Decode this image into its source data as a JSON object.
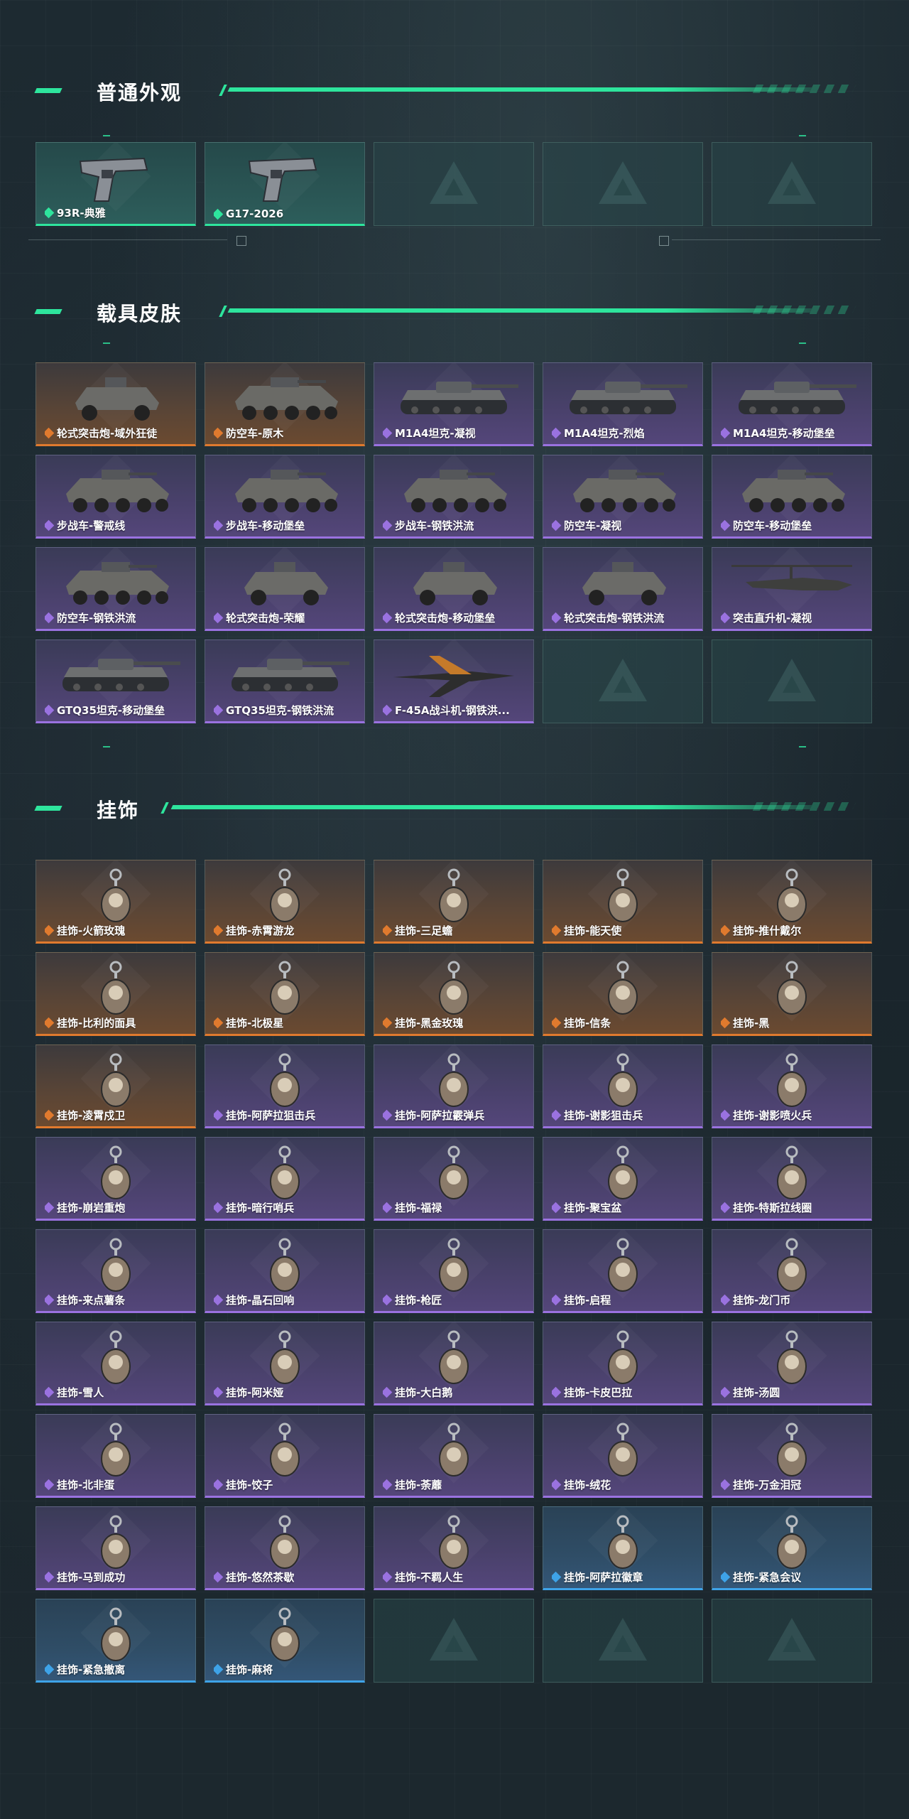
{
  "colors": {
    "accent": "#2ee59d",
    "gold": "#e07a2e",
    "purple": "#9a72e0",
    "blue": "#3ea3e8"
  },
  "sections": [
    {
      "title": "普通外观",
      "items": [
        {
          "label": "93R-典雅",
          "rarity": "green",
          "icon": "pistol-icon"
        },
        {
          "label": "G17-2026",
          "rarity": "green",
          "icon": "pistol-icon"
        },
        {
          "label": "",
          "rarity": "empty"
        },
        {
          "label": "",
          "rarity": "empty"
        },
        {
          "label": "",
          "rarity": "empty"
        }
      ]
    },
    {
      "title": "载具皮肤",
      "items": [
        {
          "label": "轮式突击炮-域外狂徒",
          "rarity": "gold",
          "icon": "armored-car-icon"
        },
        {
          "label": "防空车-原木",
          "rarity": "gold",
          "icon": "ifv-icon"
        },
        {
          "label": "M1A4坦克-凝视",
          "rarity": "purple",
          "icon": "tank-icon"
        },
        {
          "label": "M1A4坦克-烈焰",
          "rarity": "purple",
          "icon": "tank-icon"
        },
        {
          "label": "M1A4坦克-移动堡垒",
          "rarity": "purple",
          "icon": "tank-icon"
        },
        {
          "label": "步战车-警戒线",
          "rarity": "purple",
          "icon": "ifv-icon"
        },
        {
          "label": "步战车-移动堡垒",
          "rarity": "purple",
          "icon": "ifv-icon"
        },
        {
          "label": "步战车-钢铁洪流",
          "rarity": "purple",
          "icon": "ifv-icon"
        },
        {
          "label": "防空车-凝视",
          "rarity": "purple",
          "icon": "ifv-icon"
        },
        {
          "label": "防空车-移动堡垒",
          "rarity": "purple",
          "icon": "ifv-icon"
        },
        {
          "label": "防空车-钢铁洪流",
          "rarity": "purple",
          "icon": "ifv-icon"
        },
        {
          "label": "轮式突击炮-荣耀",
          "rarity": "purple",
          "icon": "armored-car-icon"
        },
        {
          "label": "轮式突击炮-移动堡垒",
          "rarity": "purple",
          "icon": "armored-car-icon"
        },
        {
          "label": "轮式突击炮-钢铁洪流",
          "rarity": "purple",
          "icon": "armored-car-icon"
        },
        {
          "label": "突击直升机-凝视",
          "rarity": "purple",
          "icon": "helicopter-icon"
        },
        {
          "label": "GTQ35坦克-移动堡垒",
          "rarity": "purple",
          "icon": "tank-icon"
        },
        {
          "label": "GTQ35坦克-钢铁洪流",
          "rarity": "purple",
          "icon": "tank-icon"
        },
        {
          "label": "F-45A战斗机-钢铁洪...",
          "rarity": "purple",
          "icon": "jet-icon"
        },
        {
          "label": "",
          "rarity": "empty"
        },
        {
          "label": "",
          "rarity": "empty"
        }
      ]
    },
    {
      "title": "挂饰",
      "items": [
        {
          "label": "挂饰-火箭玫瑰",
          "rarity": "gold",
          "icon": "charm-icon"
        },
        {
          "label": "挂饰-赤霄游龙",
          "rarity": "gold",
          "icon": "charm-icon"
        },
        {
          "label": "挂饰-三足蟾",
          "rarity": "gold",
          "icon": "charm-icon"
        },
        {
          "label": "挂饰-能天使",
          "rarity": "gold",
          "icon": "charm-icon"
        },
        {
          "label": "挂饰-推什戴尔",
          "rarity": "gold",
          "icon": "charm-icon"
        },
        {
          "label": "挂饰-比利的面具",
          "rarity": "gold",
          "icon": "charm-icon"
        },
        {
          "label": "挂饰-北极星",
          "rarity": "gold",
          "icon": "charm-icon"
        },
        {
          "label": "挂饰-黑金玫瑰",
          "rarity": "gold",
          "icon": "charm-icon"
        },
        {
          "label": "挂饰-信条",
          "rarity": "gold",
          "icon": "charm-icon"
        },
        {
          "label": "挂饰-黑",
          "rarity": "gold",
          "icon": "charm-icon"
        },
        {
          "label": "挂饰-凌霄戍卫",
          "rarity": "gold",
          "icon": "charm-icon"
        },
        {
          "label": "挂饰-阿萨拉狙击兵",
          "rarity": "purple",
          "icon": "charm-icon"
        },
        {
          "label": "挂饰-阿萨拉霰弹兵",
          "rarity": "purple",
          "icon": "charm-icon"
        },
        {
          "label": "挂饰-谢影狙击兵",
          "rarity": "purple",
          "icon": "charm-icon"
        },
        {
          "label": "挂饰-谢影喷火兵",
          "rarity": "purple",
          "icon": "charm-icon"
        },
        {
          "label": "挂饰-崩岩重炮",
          "rarity": "purple",
          "icon": "charm-icon"
        },
        {
          "label": "挂饰-暗行哨兵",
          "rarity": "purple",
          "icon": "charm-icon"
        },
        {
          "label": "挂饰-福禄",
          "rarity": "purple",
          "icon": "charm-icon"
        },
        {
          "label": "挂饰-聚宝盆",
          "rarity": "purple",
          "icon": "charm-icon"
        },
        {
          "label": "挂饰-特斯拉线圈",
          "rarity": "purple",
          "icon": "charm-icon"
        },
        {
          "label": "挂饰-来点薯条",
          "rarity": "purple",
          "icon": "charm-icon"
        },
        {
          "label": "挂饰-晶石回响",
          "rarity": "purple",
          "icon": "charm-icon"
        },
        {
          "label": "挂饰-枪匠",
          "rarity": "purple",
          "icon": "charm-icon"
        },
        {
          "label": "挂饰-启程",
          "rarity": "purple",
          "icon": "charm-icon"
        },
        {
          "label": "挂饰-龙门币",
          "rarity": "purple",
          "icon": "charm-icon"
        },
        {
          "label": "挂饰-雪人",
          "rarity": "purple",
          "icon": "charm-icon"
        },
        {
          "label": "挂饰-阿米娅",
          "rarity": "purple",
          "icon": "charm-icon"
        },
        {
          "label": "挂饰-大白鹅",
          "rarity": "purple",
          "icon": "charm-icon"
        },
        {
          "label": "挂饰-卡皮巴拉",
          "rarity": "purple",
          "icon": "charm-icon"
        },
        {
          "label": "挂饰-汤圆",
          "rarity": "purple",
          "icon": "charm-icon"
        },
        {
          "label": "挂饰-北非蛋",
          "rarity": "purple",
          "icon": "charm-icon"
        },
        {
          "label": "挂饰-饺子",
          "rarity": "purple",
          "icon": "charm-icon"
        },
        {
          "label": "挂饰-荼蘼",
          "rarity": "purple",
          "icon": "charm-icon"
        },
        {
          "label": "挂饰-绒花",
          "rarity": "purple",
          "icon": "charm-icon"
        },
        {
          "label": "挂饰-万金泪冠",
          "rarity": "purple",
          "icon": "charm-icon"
        },
        {
          "label": "挂饰-马到成功",
          "rarity": "purple",
          "icon": "charm-icon"
        },
        {
          "label": "挂饰-悠然茶歇",
          "rarity": "purple",
          "icon": "charm-icon"
        },
        {
          "label": "挂饰-不羁人生",
          "rarity": "purple",
          "icon": "charm-icon"
        },
        {
          "label": "挂饰-阿萨拉徽章",
          "rarity": "blue",
          "icon": "charm-icon"
        },
        {
          "label": "挂饰-紧急会议",
          "rarity": "blue",
          "icon": "charm-icon"
        },
        {
          "label": "挂饰-紧急撤离",
          "rarity": "blue",
          "icon": "charm-icon"
        },
        {
          "label": "挂饰-麻将",
          "rarity": "blue",
          "icon": "charm-icon"
        },
        {
          "label": "",
          "rarity": "empty"
        },
        {
          "label": "",
          "rarity": "empty"
        },
        {
          "label": "",
          "rarity": "empty"
        }
      ]
    }
  ]
}
